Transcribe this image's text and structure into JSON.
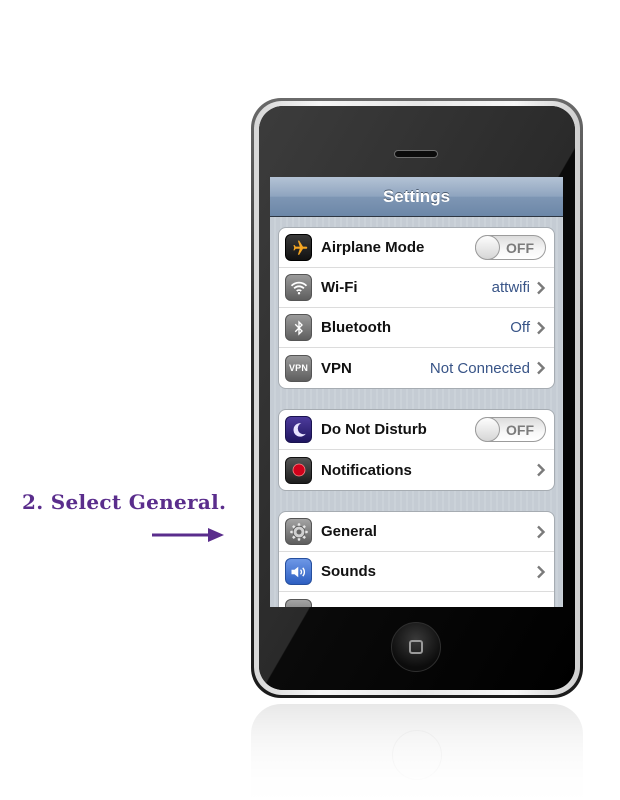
{
  "instruction": {
    "text": "2.  Select General.",
    "color": "#5a2d8c"
  },
  "screen": {
    "title": "Settings",
    "groups": [
      {
        "rows": [
          {
            "label": "Airplane Mode",
            "icon": "airplane-icon",
            "control": "toggle",
            "toggle_text": "OFF"
          },
          {
            "label": "Wi-Fi",
            "icon": "wifi-icon",
            "value": "attwifi",
            "control": "chevron"
          },
          {
            "label": "Bluetooth",
            "icon": "bluetooth-icon",
            "value": "Off",
            "control": "chevron"
          },
          {
            "label": "VPN",
            "icon": "vpn-icon",
            "icon_text": "VPN",
            "value": "Not Connected",
            "control": "chevron"
          }
        ]
      },
      {
        "rows": [
          {
            "label": "Do Not Disturb",
            "icon": "moon-icon",
            "control": "toggle",
            "toggle_text": "OFF"
          },
          {
            "label": "Notifications",
            "icon": "notification-dot-icon",
            "control": "chevron"
          }
        ]
      },
      {
        "rows": [
          {
            "label": "General",
            "icon": "gear-icon",
            "control": "chevron"
          },
          {
            "label": "Sounds",
            "icon": "speaker-icon",
            "control": "chevron"
          }
        ]
      }
    ]
  },
  "colors": {
    "value_text": "#385487",
    "navbar": "#8ea4bf",
    "table_background": "#c5ccd4"
  }
}
